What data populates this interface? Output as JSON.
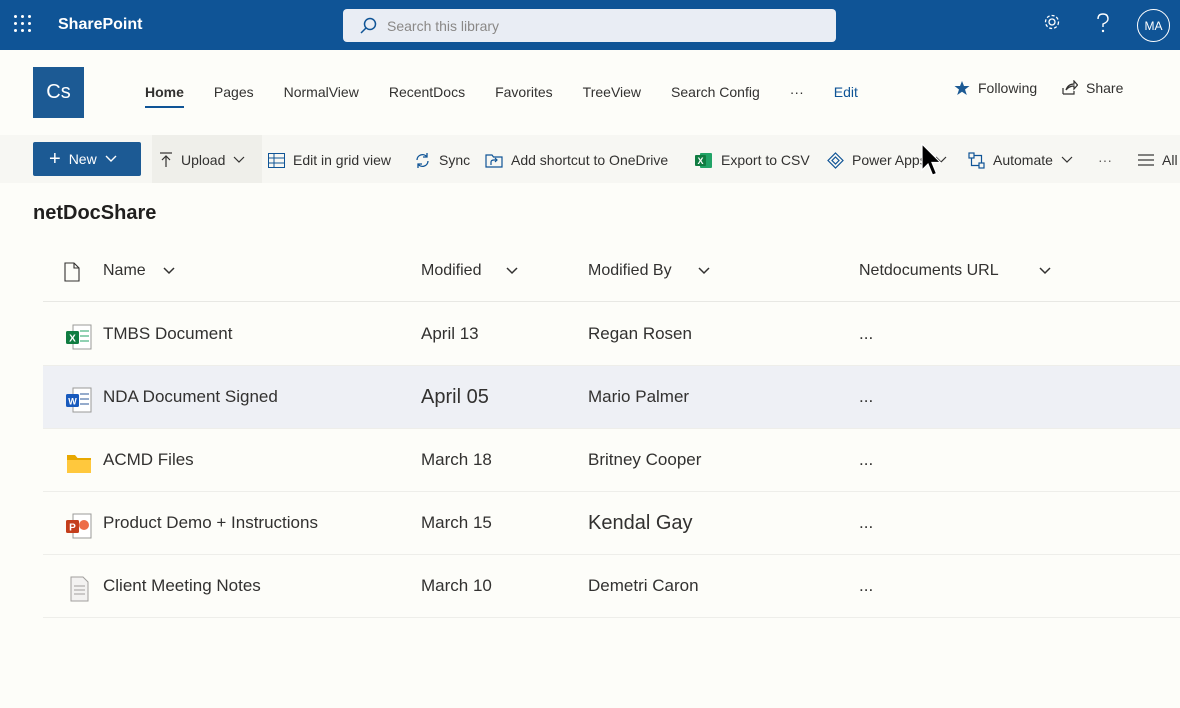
{
  "suitebar": {
    "app_name": "SharePoint",
    "search_placeholder": "Search this library",
    "avatar_initials": "MA",
    "bg_color": "#0f5496"
  },
  "site": {
    "logo_text": "Cs",
    "nav": [
      "Home",
      "Pages",
      "NormalView",
      "RecentDocs",
      "Favorites",
      "TreeView",
      "Search Config",
      "···",
      "Edit"
    ],
    "following_label": "Following",
    "share_label": "Share"
  },
  "commands": {
    "new_label": "New",
    "upload_label": "Upload",
    "grid_label": "Edit in grid view",
    "sync_label": "Sync",
    "shortcut_label": "Add shortcut to OneDrive",
    "csv_label": "Export to CSV",
    "powerapps_label": "Power Apps",
    "automate_label": "Automate",
    "more_label": "···",
    "view_label": "All"
  },
  "library": {
    "title": "netDocShare",
    "columns": [
      "Name",
      "Modified",
      "Modified By",
      "Netdocuments URL"
    ],
    "rows": [
      {
        "icon": "excel-file-icon",
        "name": "TMBS Document",
        "modified": "April 13",
        "modified_by": "Regan Rosen",
        "url": "..."
      },
      {
        "icon": "word-file-icon",
        "name": "NDA Document Signed",
        "modified": "April 05",
        "modified_by": "Mario Palmer",
        "url": "..."
      },
      {
        "icon": "folder-icon",
        "name": "ACMD Files",
        "modified": "March 18",
        "modified_by": "Britney Cooper",
        "url": "..."
      },
      {
        "icon": "powerpoint-file-icon",
        "name": "Product Demo + Instructions",
        "modified": "March 15",
        "modified_by": "Kendal Gay",
        "url": "..."
      },
      {
        "icon": "text-file-icon",
        "name": "Client Meeting Notes",
        "modified": "March 10",
        "modified_by": "Demetri Caron",
        "url": "..."
      }
    ]
  }
}
